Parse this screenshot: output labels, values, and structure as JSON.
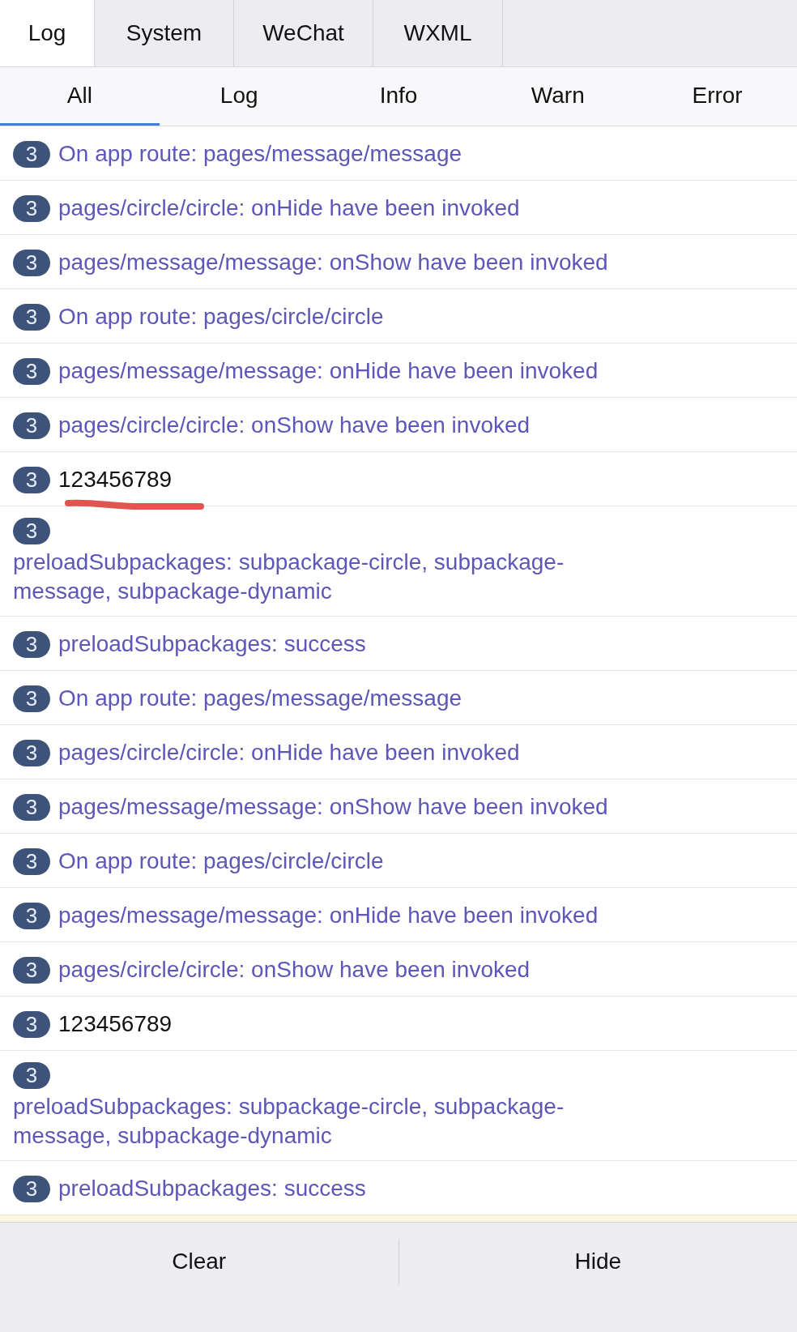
{
  "tabs": [
    {
      "label": "Log",
      "selected": true
    },
    {
      "label": "System",
      "selected": false
    },
    {
      "label": "WeChat",
      "selected": false
    },
    {
      "label": "WXML",
      "selected": false
    }
  ],
  "filters": [
    {
      "label": "All",
      "selected": true
    },
    {
      "label": "Log",
      "selected": false
    },
    {
      "label": "Info",
      "selected": false
    },
    {
      "label": "Warn",
      "selected": false
    },
    {
      "label": "Error",
      "selected": false
    }
  ],
  "rows": [
    {
      "count": "3",
      "text": "On app route: pages/message/message",
      "kind": "info",
      "underlined": false
    },
    {
      "count": "3",
      "text": "pages/circle/circle: onHide have been invoked",
      "kind": "info",
      "underlined": false
    },
    {
      "count": "3",
      "text": "pages/message/message: onShow have been invoked",
      "kind": "info",
      "underlined": false
    },
    {
      "count": "3",
      "text": "On app route: pages/circle/circle",
      "kind": "info",
      "underlined": false
    },
    {
      "count": "3",
      "text": "pages/message/message: onHide have been invoked",
      "kind": "info",
      "underlined": false
    },
    {
      "count": "3",
      "text": "pages/circle/circle: onShow have been invoked",
      "kind": "info",
      "underlined": false
    },
    {
      "count": "3",
      "text": "123456789",
      "kind": "log",
      "underlined": true
    },
    {
      "count": "3",
      "text": "preloadSubpackages: subpackage-circle, subpackage-message, subpackage-dynamic",
      "kind": "info-block",
      "underlined": false
    },
    {
      "count": "3",
      "text": "preloadSubpackages: success",
      "kind": "info",
      "underlined": false
    },
    {
      "count": "3",
      "text": "On app route: pages/message/message",
      "kind": "info",
      "underlined": false
    },
    {
      "count": "3",
      "text": "pages/circle/circle: onHide have been invoked",
      "kind": "info",
      "underlined": false
    },
    {
      "count": "3",
      "text": "pages/message/message: onShow have been invoked",
      "kind": "info",
      "underlined": false
    },
    {
      "count": "3",
      "text": "On app route: pages/circle/circle",
      "kind": "info",
      "underlined": false
    },
    {
      "count": "3",
      "text": "pages/message/message: onHide have been invoked",
      "kind": "info",
      "underlined": false
    },
    {
      "count": "3",
      "text": "pages/circle/circle: onShow have been invoked",
      "kind": "info",
      "underlined": false
    },
    {
      "count": "3",
      "text": "123456789",
      "kind": "log",
      "underlined": false
    },
    {
      "count": "3",
      "text": "preloadSubpackages: subpackage-circle, subpackage-message, subpackage-dynamic",
      "kind": "info-block",
      "underlined": false
    },
    {
      "count": "3",
      "text": "preloadSubpackages: success",
      "kind": "info",
      "underlined": false
    }
  ],
  "buttons": [
    "Clear",
    "Hide"
  ]
}
